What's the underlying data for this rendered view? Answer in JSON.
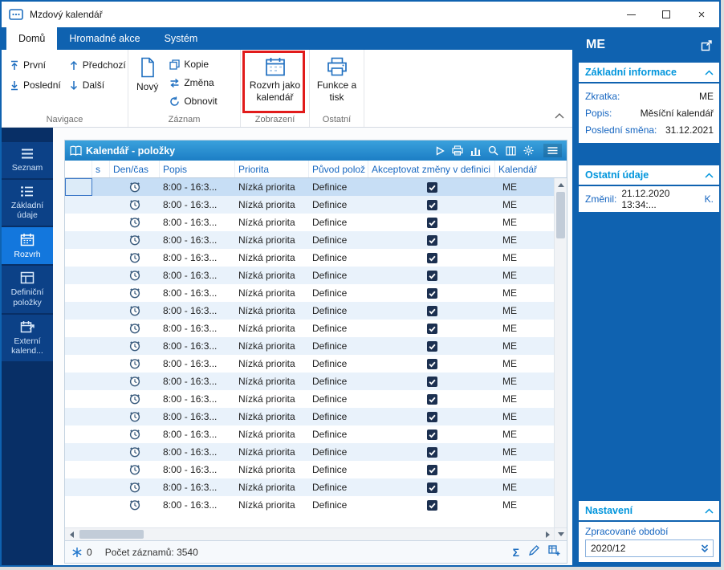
{
  "window": {
    "title": "Mzdový kalendář"
  },
  "colors": {
    "accent": "#0f62b0",
    "sidebar": "#082f66",
    "highlight_red": "#e11b1b",
    "grid_header_top": "#3aa1dc",
    "grid_header_bottom": "#1c7ec5",
    "selection": "#c7def5"
  },
  "ribbon": {
    "tabs": [
      {
        "label": "Domů",
        "active": true
      },
      {
        "label": "Hromadné akce",
        "active": false
      },
      {
        "label": "Systém",
        "active": false
      }
    ],
    "groups": {
      "navigace": {
        "label": "Navigace",
        "items": [
          {
            "label": "První",
            "icon": "arrow-up-bar-icon"
          },
          {
            "label": "Poslední",
            "icon": "arrow-down-bar-icon"
          },
          {
            "label": "Předchozí",
            "icon": "arrow-up-icon"
          },
          {
            "label": "Další",
            "icon": "arrow-down-icon"
          }
        ]
      },
      "zaznam": {
        "label": "Záznam",
        "novy": "Nový",
        "kopie": "Kopie",
        "zmena": "Změna",
        "obnovit": "Obnovit"
      },
      "zobrazeni": {
        "label": "Zobrazení",
        "button": "Rozvrh jako kalendář"
      },
      "ostatni": {
        "label": "Ostatní",
        "button": "Funkce a tisk"
      }
    }
  },
  "sidebar": {
    "items": [
      {
        "label": "Seznam",
        "active": false
      },
      {
        "label": "Základní údaje",
        "active": false
      },
      {
        "label": "Rozvrh",
        "active": true
      },
      {
        "label": "Definiční položky",
        "active": false
      },
      {
        "label": "Externí kalend...",
        "active": false
      }
    ]
  },
  "grid": {
    "title": "Kalendář - položky",
    "columns": [
      "",
      "s",
      "Den/čas",
      "Popis",
      "Priorita",
      "Původ polož",
      "Akceptovat změny v definici",
      "Kalendář"
    ],
    "rows": [
      {
        "popis": "8:00 - 16:3...",
        "priorita": "Nízká priorita",
        "puvod": "Definice",
        "akceptovat": true,
        "kalendar": "ME"
      },
      {
        "popis": "8:00 - 16:3...",
        "priorita": "Nízká priorita",
        "puvod": "Definice",
        "akceptovat": true,
        "kalendar": "ME"
      },
      {
        "popis": "8:00 - 16:3...",
        "priorita": "Nízká priorita",
        "puvod": "Definice",
        "akceptovat": true,
        "kalendar": "ME"
      },
      {
        "popis": "8:00 - 16:3...",
        "priorita": "Nízká priorita",
        "puvod": "Definice",
        "akceptovat": true,
        "kalendar": "ME"
      },
      {
        "popis": "8:00 - 16:3...",
        "priorita": "Nízká priorita",
        "puvod": "Definice",
        "akceptovat": true,
        "kalendar": "ME"
      },
      {
        "popis": "8:00 - 16:3...",
        "priorita": "Nízká priorita",
        "puvod": "Definice",
        "akceptovat": true,
        "kalendar": "ME"
      },
      {
        "popis": "8:00 - 16:3...",
        "priorita": "Nízká priorita",
        "puvod": "Definice",
        "akceptovat": true,
        "kalendar": "ME"
      },
      {
        "popis": "8:00 - 16:3...",
        "priorita": "Nízká priorita",
        "puvod": "Definice",
        "akceptovat": true,
        "kalendar": "ME"
      },
      {
        "popis": "8:00 - 16:3...",
        "priorita": "Nízká priorita",
        "puvod": "Definice",
        "akceptovat": true,
        "kalendar": "ME"
      },
      {
        "popis": "8:00 - 16:3...",
        "priorita": "Nízká priorita",
        "puvod": "Definice",
        "akceptovat": true,
        "kalendar": "ME"
      },
      {
        "popis": "8:00 - 16:3...",
        "priorita": "Nízká priorita",
        "puvod": "Definice",
        "akceptovat": true,
        "kalendar": "ME"
      },
      {
        "popis": "8:00 - 16:3...",
        "priorita": "Nízká priorita",
        "puvod": "Definice",
        "akceptovat": true,
        "kalendar": "ME"
      },
      {
        "popis": "8:00 - 16:3...",
        "priorita": "Nízká priorita",
        "puvod": "Definice",
        "akceptovat": true,
        "kalendar": "ME"
      },
      {
        "popis": "8:00 - 16:3...",
        "priorita": "Nízká priorita",
        "puvod": "Definice",
        "akceptovat": true,
        "kalendar": "ME"
      },
      {
        "popis": "8:00 - 16:3...",
        "priorita": "Nízká priorita",
        "puvod": "Definice",
        "akceptovat": true,
        "kalendar": "ME"
      },
      {
        "popis": "8:00 - 16:3...",
        "priorita": "Nízká priorita",
        "puvod": "Definice",
        "akceptovat": true,
        "kalendar": "ME"
      },
      {
        "popis": "8:00 - 16:3...",
        "priorita": "Nízká priorita",
        "puvod": "Definice",
        "akceptovat": true,
        "kalendar": "ME"
      },
      {
        "popis": "8:00 - 16:3...",
        "priorita": "Nízká priorita",
        "puvod": "Definice",
        "akceptovat": true,
        "kalendar": "ME"
      },
      {
        "popis": "8:00 - 16:3...",
        "priorita": "Nízká priorita",
        "puvod": "Definice",
        "akceptovat": true,
        "kalendar": "ME"
      }
    ],
    "status": {
      "counter": "0",
      "records": "Počet záznamů: 3540",
      "sum_icon": "Σ"
    }
  },
  "panel": {
    "title": "ME",
    "sections": [
      {
        "title": "Základní informace",
        "fields": [
          {
            "label": "Zkratka:",
            "value": "ME"
          },
          {
            "label": "Popis:",
            "value": "Měsíční kalendář"
          },
          {
            "label": "Poslední směna:",
            "value": "31.12.2021"
          }
        ]
      },
      {
        "title": "Ostatní údaje",
        "fields": [
          {
            "label": "Změnil:",
            "value": "21.12.2020 13:34:...",
            "extra": "K."
          }
        ]
      },
      {
        "title": "Nastavení",
        "field_label": "Zpracované období",
        "combo_value": "2020/12"
      }
    ]
  }
}
